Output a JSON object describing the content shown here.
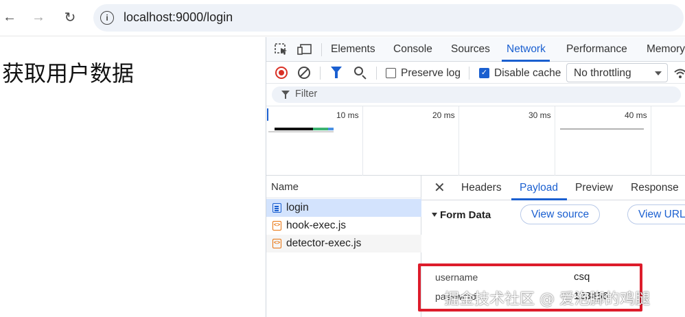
{
  "browser": {
    "url": "localhost:9000/login",
    "back_icon": "←",
    "forward_icon": "→",
    "reload_icon": "↻",
    "info_icon": "i"
  },
  "page": {
    "title": "获取用户数据"
  },
  "devtools": {
    "tabs": [
      "Elements",
      "Console",
      "Sources",
      "Network",
      "Performance",
      "Memory"
    ],
    "active_tab": "Network",
    "toolbar": {
      "preserve_log_label": "Preserve log",
      "preserve_log_checked": false,
      "disable_cache_label": "Disable cache",
      "disable_cache_checked": true,
      "throttling_value": "No throttling"
    },
    "filter": {
      "placeholder": "Filter"
    },
    "overview": {
      "ticks": [
        "10 ms",
        "20 ms",
        "30 ms",
        "40 ms"
      ]
    },
    "request_list": {
      "header": "Name",
      "rows": [
        {
          "name": "login",
          "type": "document",
          "selected": true
        },
        {
          "name": "hook-exec.js",
          "type": "script",
          "selected": false
        },
        {
          "name": "detector-exec.js",
          "type": "script",
          "selected": false
        }
      ]
    },
    "detail": {
      "tabs": [
        "Headers",
        "Payload",
        "Preview",
        "Response"
      ],
      "active_tab": "Payload",
      "form_data": {
        "title": "Form Data",
        "view_source_label": "View source",
        "view_url_label": "View URL",
        "fields": [
          {
            "key": "username",
            "value": "csq"
          },
          {
            "key": "password",
            "value": "123456"
          }
        ]
      }
    }
  },
  "watermark": "掘金技术社区 @ 爱泡脚的鸡腿",
  "colors": {
    "accent": "#1a5fd0",
    "highlight_box": "#dd1c2b",
    "record": "#d93025"
  }
}
